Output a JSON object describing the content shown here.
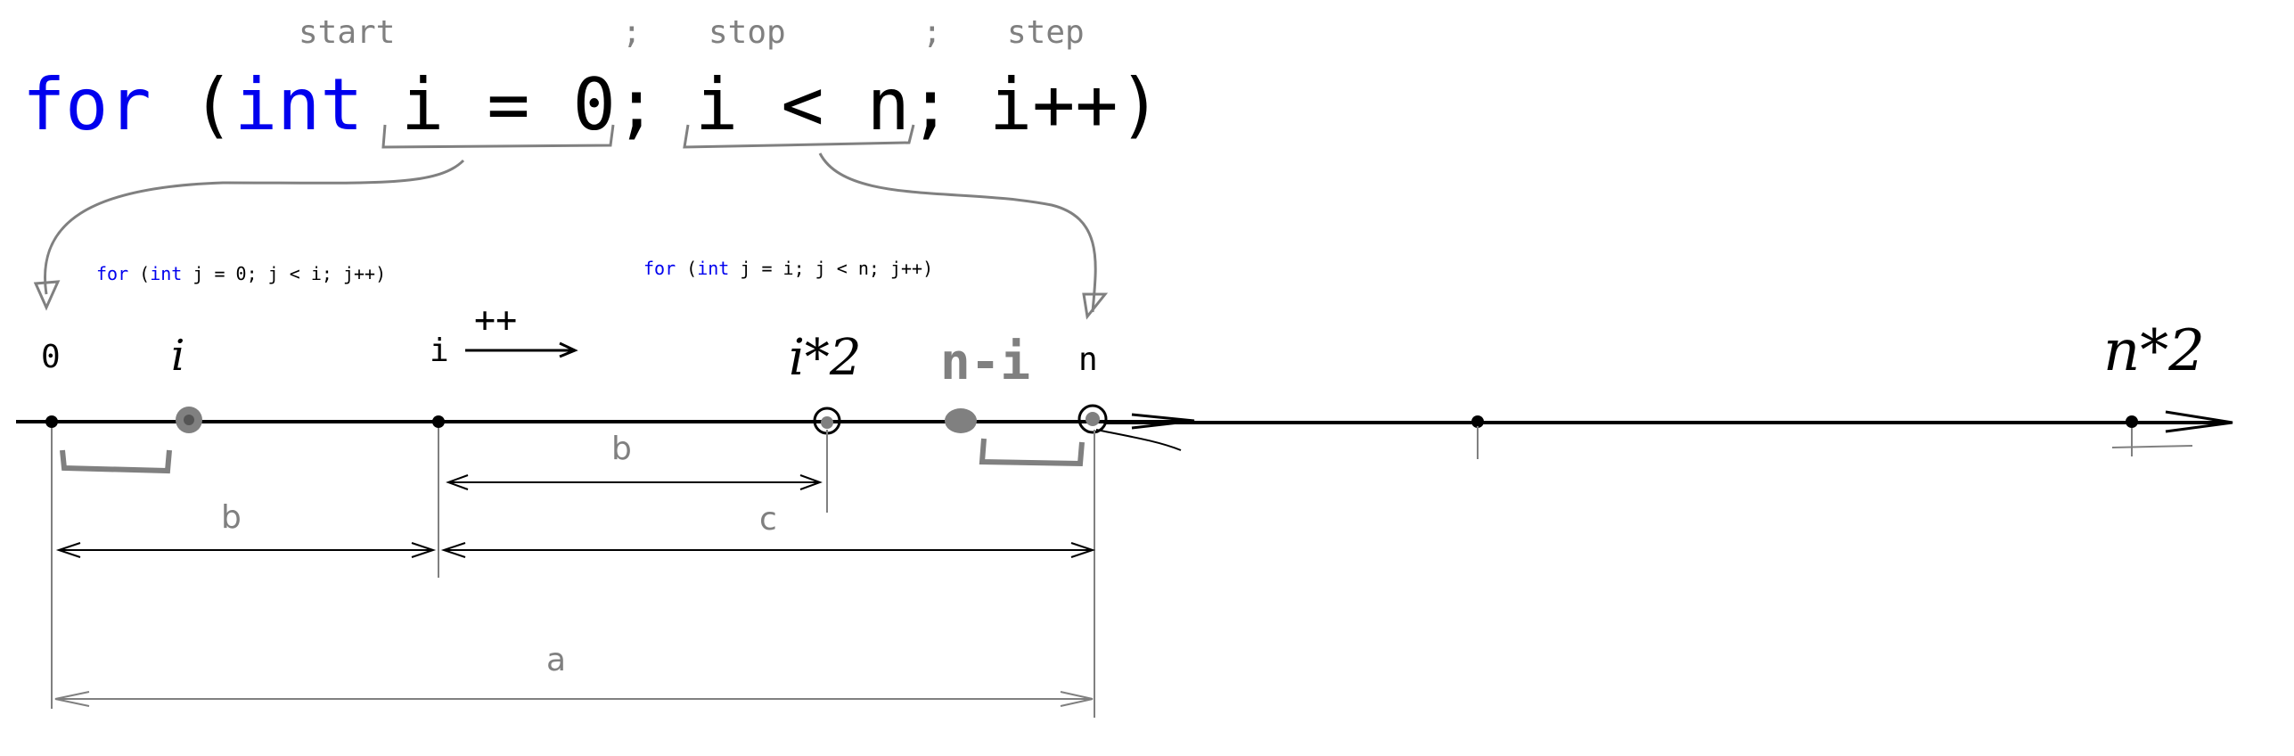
{
  "header_labels": {
    "start": "start",
    "sep1": ";",
    "stop": "stop",
    "sep2": ";",
    "step": "step"
  },
  "outer_loop": {
    "kw_for": "for",
    "paren_open": "(",
    "kw_int": "int",
    "init": "i = 0",
    "semi1": ";",
    "cond": "i < n",
    "semi2": ";",
    "incr": "i++",
    "paren_close": ")"
  },
  "inner_loop_left": {
    "kw_for": "for",
    "paren": "(",
    "kw_int": "int",
    "rest": "j = 0; j < i; j++)"
  },
  "inner_loop_right": {
    "kw_for": "for",
    "paren": "(",
    "kw_int": "int",
    "rest": "j = i; j < n; j++)"
  },
  "axis_labels": {
    "zero": "0",
    "i_hand": "i",
    "i": "i",
    "plusplus": "++",
    "i_times_2": "i*2",
    "n_minus_i": "n-i",
    "n": "n",
    "n_times_2": "n*2"
  },
  "dimensions": {
    "b_top": "b",
    "b_left": "b",
    "c": "c",
    "a": "a"
  },
  "colors": {
    "keyword": "#0000ee",
    "text": "#000000",
    "annotation": "#808080"
  }
}
